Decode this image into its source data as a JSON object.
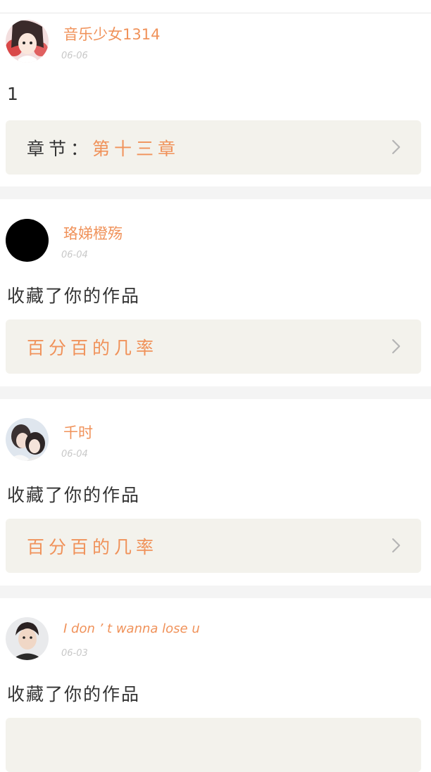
{
  "items": [
    {
      "name": "音乐少女1314",
      "date": "06-06",
      "message": "1",
      "card": {
        "label": "章节：",
        "value": "第十三章"
      }
    },
    {
      "name": "珞娣橙殇",
      "date": "06-04",
      "message": "收藏了你的作品",
      "card": {
        "label": "",
        "value": "百分百的几率"
      }
    },
    {
      "name": "千时",
      "date": "06-04",
      "message": "收藏了你的作品",
      "card": {
        "label": "",
        "value": "百分百的几率"
      }
    },
    {
      "name": "I don ’ t wanna lose u",
      "date": "06-03",
      "message": "收藏了你的作品"
    }
  ],
  "colors": {
    "accent": "#f0925a",
    "card_bg": "#f3f2ec",
    "separator": "#f4f4f4"
  }
}
